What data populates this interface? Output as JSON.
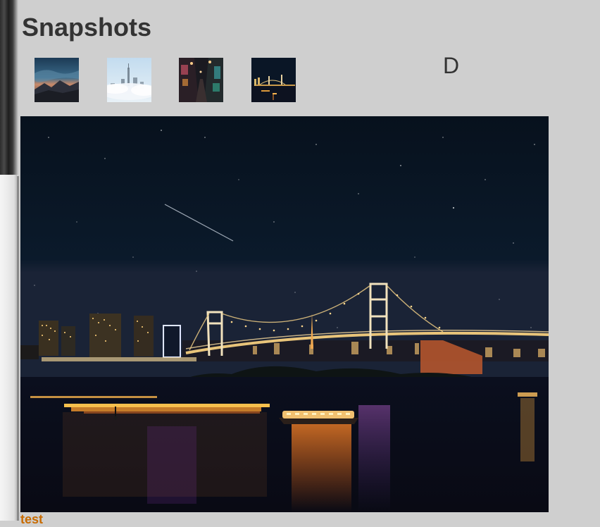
{
  "page": {
    "title": "Snapshots",
    "corner_letter": "D",
    "caption": "test"
  },
  "thumbnails": [
    {
      "icon": "mountain-sunset-thumbnail",
      "selected": false
    },
    {
      "icon": "foggy-city-thumbnail",
      "selected": false
    },
    {
      "icon": "neon-street-thumbnail",
      "selected": false
    },
    {
      "icon": "night-bridge-thumbnail",
      "selected": true
    }
  ],
  "main_image": {
    "icon": "night-bridge-photo"
  },
  "colors": {
    "background": "#cfcfcf",
    "title": "#333333",
    "caption": "#c86b00"
  }
}
